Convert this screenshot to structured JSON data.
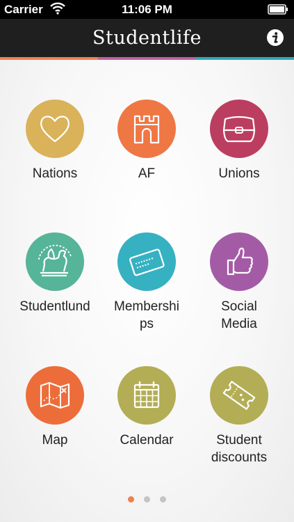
{
  "status_bar": {
    "carrier": "Carrier",
    "time": "11:06 PM"
  },
  "nav": {
    "title": "Studentlife",
    "info_icon": "info-icon"
  },
  "stripe_colors": [
    "#f08050",
    "#c060a0",
    "#30a8b8"
  ],
  "tiles": [
    {
      "label": "Nations",
      "icon": "heart-icon",
      "color": "#d9b25a"
    },
    {
      "label": "AF",
      "icon": "castle-icon",
      "color": "#ef7744"
    },
    {
      "label": "Unions",
      "icon": "pouch-icon",
      "color": "#bb3e61"
    },
    {
      "label": "Studentlund",
      "icon": "griffin-icon",
      "color": "#56b498"
    },
    {
      "label": "Membershi\nps",
      "icon": "card-icon",
      "color": "#36b1c1"
    },
    {
      "label": "Social\nMedia",
      "icon": "thumbs-up-icon",
      "color": "#a45ba6"
    },
    {
      "label": "Map",
      "icon": "map-icon",
      "color": "#ed6d3a"
    },
    {
      "label": "Calendar",
      "icon": "calendar-icon",
      "color": "#b3ad55"
    },
    {
      "label": "Student\ndiscounts",
      "icon": "ticket-icon",
      "color": "#b3ad55"
    }
  ],
  "pagination": {
    "current": 1,
    "total": 3,
    "active_color": "#f08050",
    "inactive_color": "#c4c4c4"
  }
}
